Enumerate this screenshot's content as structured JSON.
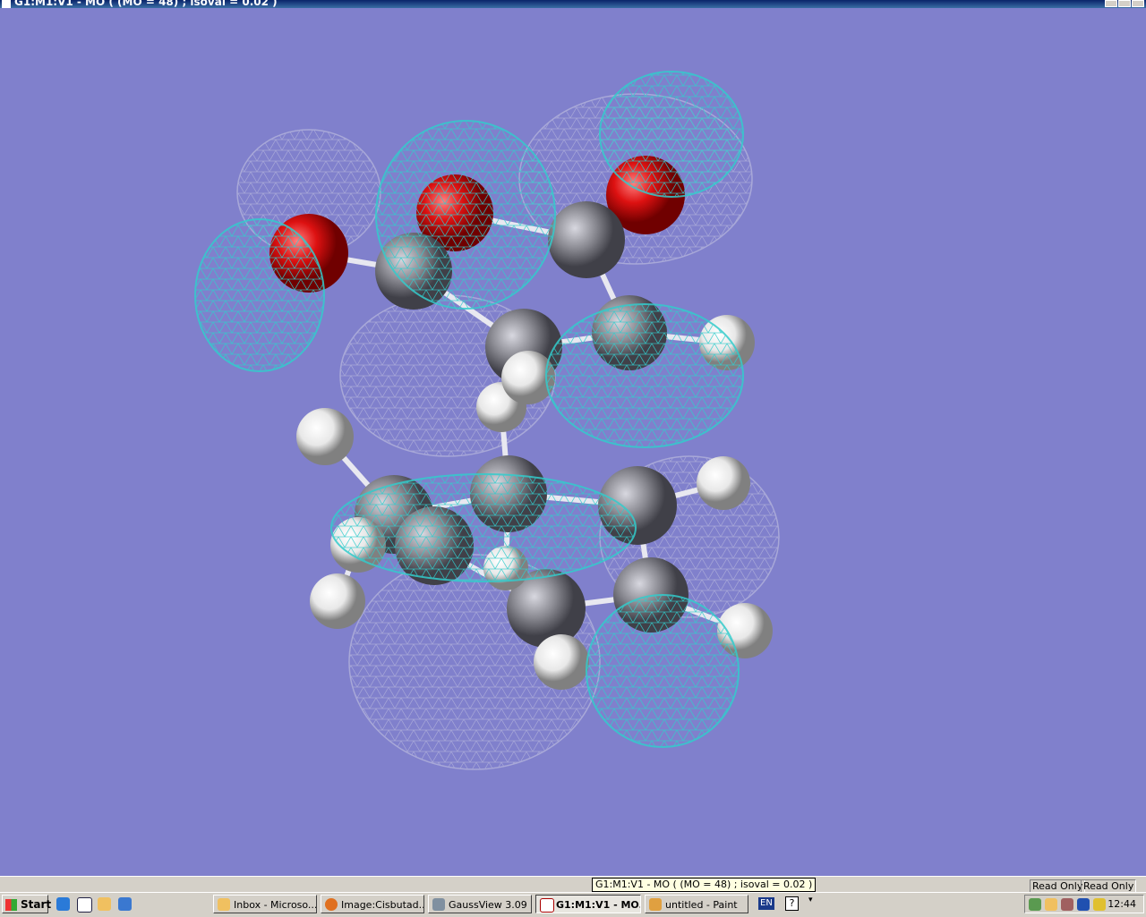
{
  "window": {
    "title": "G1:M1:V1 - MO ( (MO = 48) ; isoval = 0.02 )"
  },
  "viewport": {
    "background": "#8080cc",
    "mo_number": 48,
    "isovalue": 0.02,
    "positive_lobe_color": "#33cccc",
    "negative_lobe_color": "#a8a8d8",
    "oxygen_color": "#dd1111",
    "carbon_color": "#888890",
    "hydrogen_color": "#f0f0f0"
  },
  "status": {
    "tooltip": "G1:M1:V1 - MO ( (MO = 48) ; isoval = 0.02 )",
    "panel1": "Read Only",
    "panel2": "Read Only"
  },
  "taskbar": {
    "start": "Start",
    "quicklaunch": [
      "internet-explorer-icon",
      "show-desktop-icon",
      "outlook-icon",
      "app-icon"
    ],
    "items": [
      {
        "label": "Inbox - Microso...",
        "icon": "outlook-icon"
      },
      {
        "label": "Image:Cisbutad...",
        "icon": "firefox-icon"
      },
      {
        "label": "GaussView 3.09",
        "icon": "gaussview-icon"
      },
      {
        "label": "G1:M1:V1 - MO...",
        "icon": "molecule-window-icon",
        "active": true
      },
      {
        "label": "untitled - Paint",
        "icon": "paint-icon"
      }
    ],
    "language": "EN",
    "help": "?",
    "clock": "12:44"
  }
}
